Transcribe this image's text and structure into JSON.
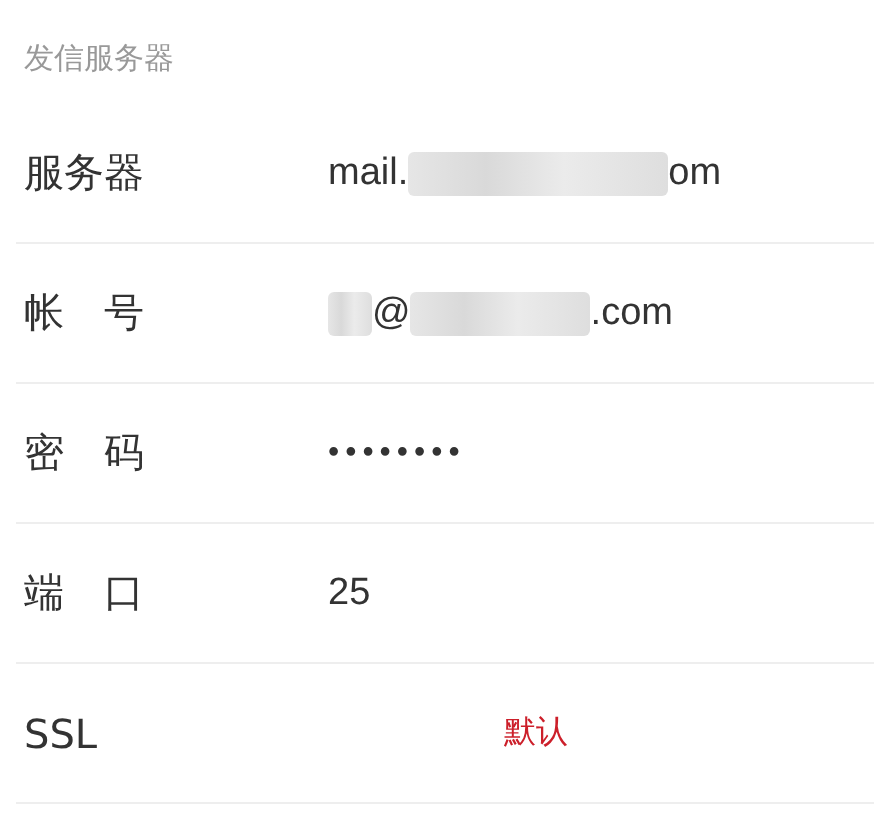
{
  "section_title": "发信服务器",
  "fields": [
    {
      "label": "服务器",
      "kind": "text",
      "segments": [
        {
          "kind": "text",
          "text": "mail."
        },
        {
          "kind": "blur"
        },
        {
          "kind": "text",
          "text": "om"
        }
      ]
    },
    {
      "label": "帐　号",
      "kind": "text",
      "segments": [
        {
          "kind": "blur"
        },
        {
          "kind": "text",
          "text": "@"
        },
        {
          "kind": "blur"
        },
        {
          "kind": "text",
          "text": ".com"
        }
      ]
    },
    {
      "label": "密　码",
      "kind": "password",
      "value": "••••••••"
    },
    {
      "label": "端　口",
      "kind": "text",
      "segments": [
        {
          "kind": "text",
          "text": "25"
        }
      ]
    },
    {
      "label": "SSL",
      "kind": "note",
      "value": "默认",
      "color": "#cc1f2a"
    }
  ]
}
